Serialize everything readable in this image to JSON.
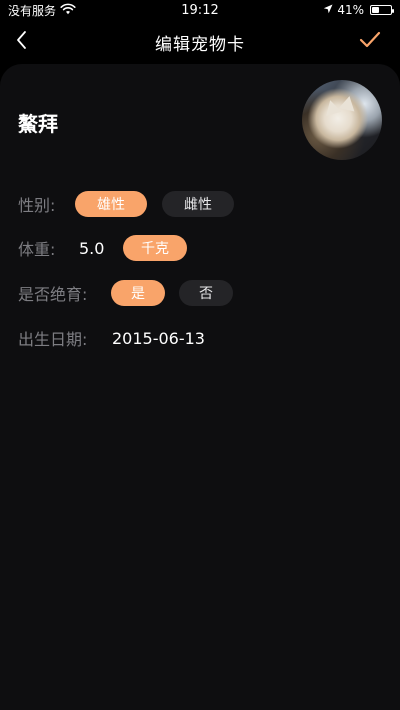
{
  "status_bar": {
    "carrier": "没有服务",
    "time": "19:12",
    "battery": "41%",
    "battery_level": 0.41
  },
  "nav": {
    "title": "编辑宠物卡"
  },
  "pet": {
    "name": "鰲拜"
  },
  "form": {
    "gender_label": "性别:",
    "gender_options": [
      "雄性",
      "雌性"
    ],
    "gender_selected": "雄性",
    "weight_label": "体重:",
    "weight_value": "5.0",
    "weight_unit": "千克",
    "neutered_label": "是否绝育:",
    "neutered_options": [
      "是",
      "否"
    ],
    "neutered_selected": "是",
    "birthday_label": "出生日期:",
    "birthday_value": "2015-06-13"
  },
  "colors": {
    "accent": "#f9a46a",
    "background": "#000000",
    "card": "#0e0e10",
    "chip_inactive": "#242427",
    "label": "#7d7d82"
  },
  "icons": {
    "back": "chevron-left-icon",
    "done": "checkmark-icon",
    "wifi": "wifi-icon",
    "location": "location-arrow-icon",
    "battery": "battery-icon"
  }
}
